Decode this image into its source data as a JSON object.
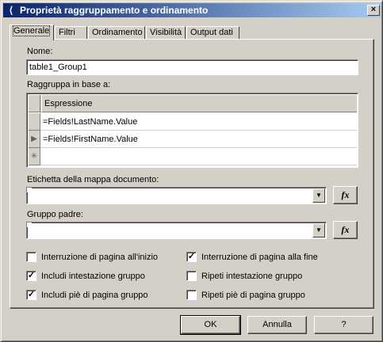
{
  "window": {
    "title": "Proprietà raggruppamento e ordinamento",
    "close_label": "×"
  },
  "tabs": [
    "Generale",
    "Filtri",
    "Ordinamento",
    "Visibilità",
    "Output dati"
  ],
  "name": {
    "label": "Nome:",
    "value": "table1_Group1"
  },
  "group_by": {
    "label": "Raggruppa in base a:",
    "column_header": "Espressione",
    "rows": [
      "=Fields!LastName.Value",
      "=Fields!FirstName.Value",
      ""
    ],
    "new_row_marker": "✳",
    "current_row_marker": "▶"
  },
  "doc_map": {
    "label": "Etichetta della mappa documento:",
    "value": ""
  },
  "parent_group": {
    "label": "Gruppo padre:",
    "value": ""
  },
  "fx_label": "fx",
  "checkboxes": {
    "page_break_start": {
      "label": "Interruzione di pagina all'inizio",
      "checked": false
    },
    "include_header": {
      "label": "Includi intestazione gruppo",
      "checked": true
    },
    "include_footer": {
      "label": "Includi piè di pagina gruppo",
      "checked": true
    },
    "page_break_end": {
      "label": "Interruzione di pagina alla fine",
      "checked": true
    },
    "repeat_header": {
      "label": "Ripeti intestazione gruppo",
      "checked": false
    },
    "repeat_footer": {
      "label": "Ripeti piè di pagina gruppo",
      "checked": false
    }
  },
  "buttons": {
    "ok": "OK",
    "cancel": "Annulla",
    "help": "?"
  }
}
